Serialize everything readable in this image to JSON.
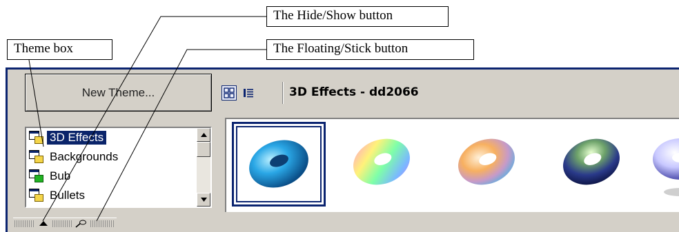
{
  "callouts": {
    "hide_show": "The Hide/Show button",
    "theme_box": "Theme box",
    "floating_stick": "The Floating/Stick button"
  },
  "gallery_panel": {
    "new_theme_label": "New Theme...",
    "title": "3D Effects - dd2066",
    "themes": [
      {
        "label": "3D Effects",
        "icon": "theme-folder-icon",
        "selected": true
      },
      {
        "label": "Backgrounds",
        "icon": "theme-folder-icon",
        "selected": false
      },
      {
        "label": "Bub",
        "icon": "theme-folder-green-icon",
        "selected": false
      },
      {
        "label": "Bullets",
        "icon": "theme-folder-icon",
        "selected": false
      }
    ],
    "view_buttons": [
      "icon-view-icon",
      "detail-view-icon"
    ],
    "bottom_buttons": [
      "hide-show-icon",
      "floating-stick-icon"
    ]
  },
  "colors": {
    "frame_border": "#0b2470",
    "selection": "#0a246a",
    "chrome": "#d4d0c8"
  }
}
